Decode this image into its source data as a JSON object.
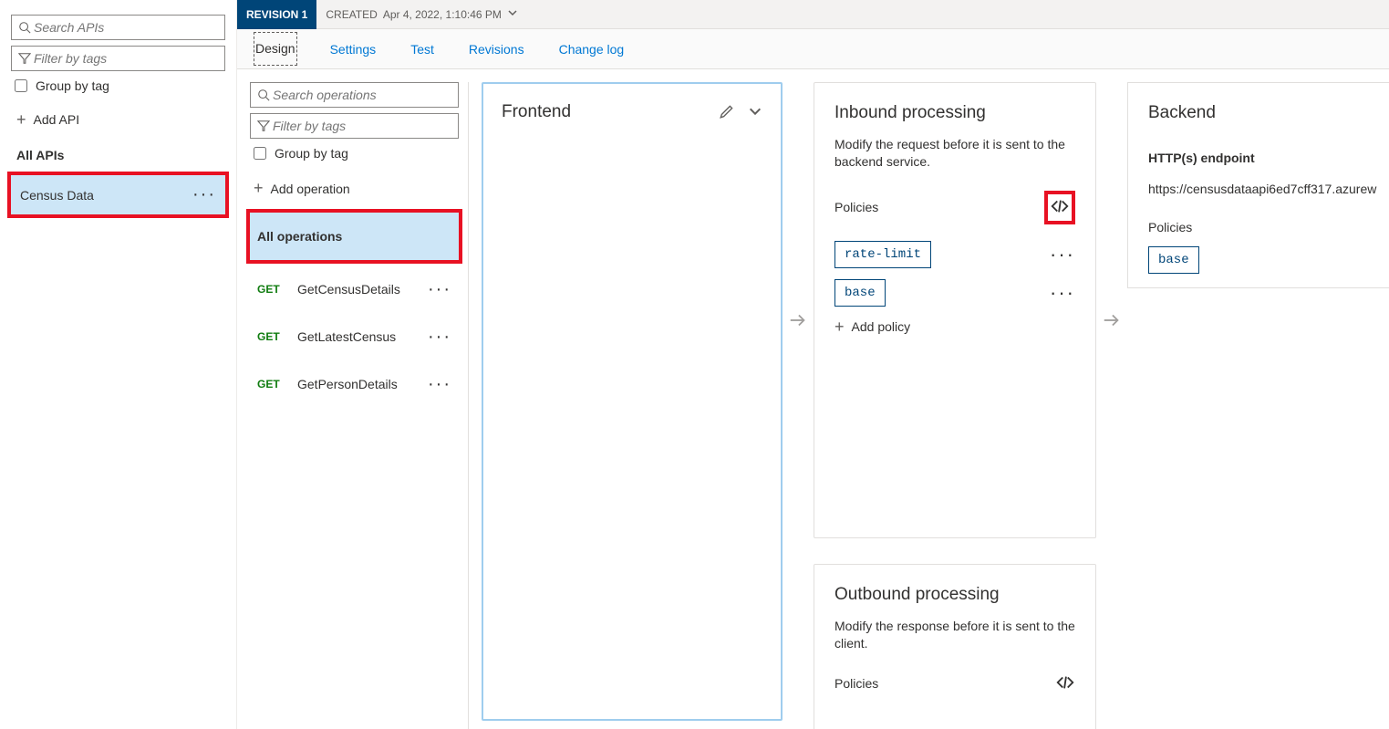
{
  "sidebar": {
    "search_placeholder": "Search APIs",
    "filter_placeholder": "Filter by tags",
    "group_by_tag_label": "Group by tag",
    "add_api_label": "Add API",
    "all_apis_label": "All APIs",
    "selected_api": "Census Data"
  },
  "revision": {
    "badge": "REVISION 1",
    "created_label": "CREATED",
    "created_value": "Apr 4, 2022, 1:10:46 PM"
  },
  "tabs": {
    "design": "Design",
    "settings": "Settings",
    "test": "Test",
    "revisions": "Revisions",
    "changelog": "Change log"
  },
  "ops": {
    "search_placeholder": "Search operations",
    "filter_placeholder": "Filter by tags",
    "group_by_tag_label": "Group by tag",
    "add_operation_label": "Add operation",
    "all_operations_label": "All operations",
    "list": [
      {
        "method": "GET",
        "name": "GetCensusDetails"
      },
      {
        "method": "GET",
        "name": "GetLatestCensus"
      },
      {
        "method": "GET",
        "name": "GetPersonDetails"
      }
    ]
  },
  "frontend": {
    "title": "Frontend"
  },
  "inbound": {
    "title": "Inbound processing",
    "desc": "Modify the request before it is sent to the backend service.",
    "policies_label": "Policies",
    "policies": [
      "rate-limit",
      "base"
    ],
    "add_policy_label": "Add policy"
  },
  "outbound": {
    "title": "Outbound processing",
    "desc": "Modify the response before it is sent to the client.",
    "policies_label": "Policies"
  },
  "backend": {
    "title": "Backend",
    "endpoint_label": "HTTP(s) endpoint",
    "endpoint_url": "https://censusdataapi6ed7cff317.azurew",
    "policies_label": "Policies",
    "policies": [
      "base"
    ]
  }
}
